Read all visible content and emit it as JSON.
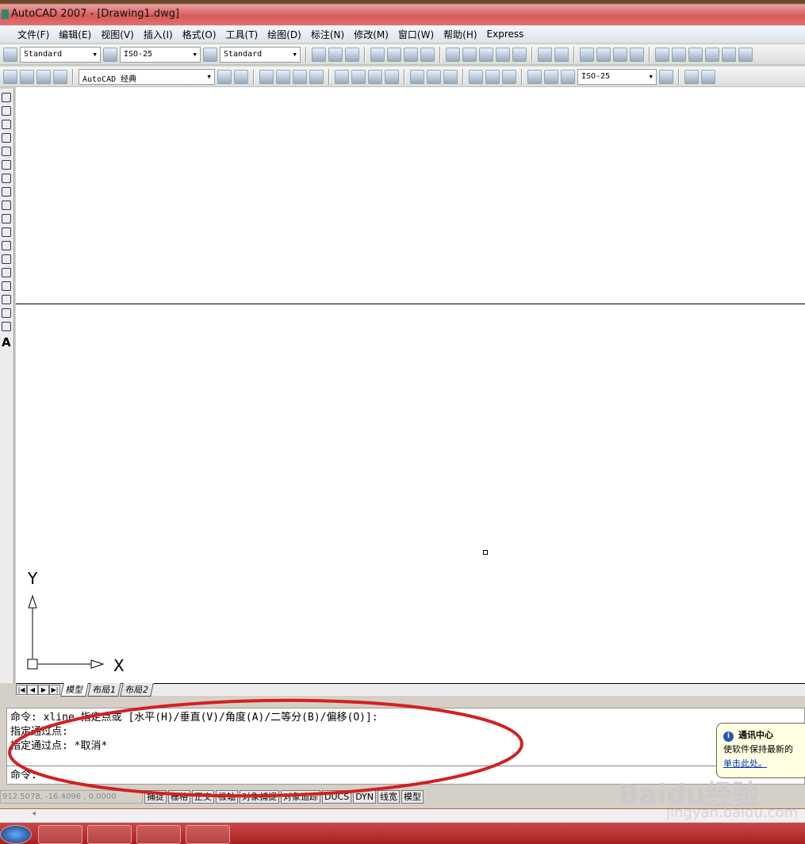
{
  "window": {
    "title": "AutoCAD 2007 - [Drawing1.dwg]"
  },
  "menu": [
    "文件(F)",
    "编辑(E)",
    "视图(V)",
    "插入(I)",
    "格式(O)",
    "工具(T)",
    "绘图(D)",
    "标注(N)",
    "修改(M)",
    "窗口(W)",
    "帮助(H)",
    "Express"
  ],
  "toolbar1": {
    "text_style": "Standard",
    "dim_style": "ISO-25",
    "table_style": "Standard"
  },
  "toolbar2": {
    "workspace": "AutoCAD 经典",
    "dim_style": "ISO-25"
  },
  "ucs": {
    "x_label": "X",
    "y_label": "Y"
  },
  "tabs": [
    "模型",
    "布局1",
    "布局2"
  ],
  "command": {
    "lines": [
      "命令:  xline 指定点或 [水平(H)/垂直(V)/角度(A)/二等分(B)/偏移(O)]:",
      "指定通过点:",
      "指定通过点: *取消*"
    ],
    "prompt": "命令:"
  },
  "status": {
    "coords": "912.5078,  -16.4096 , 0.0000",
    "buttons": [
      "捕捉",
      "栅格",
      "正交",
      "极轴",
      "对象捕捉",
      "对象追踪",
      "DUCS",
      "DYN",
      "线宽",
      "模型"
    ]
  },
  "balloon": {
    "title": "通讯中心",
    "text": "使软件保持最新的",
    "link": "单击此处。"
  },
  "watermark": {
    "logo": "Baidu经验",
    "url": "jingyan.baidu.com"
  },
  "annotation_color": "#d42020"
}
